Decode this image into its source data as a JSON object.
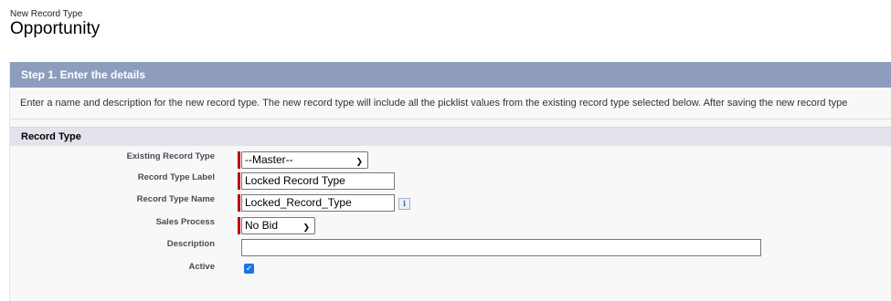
{
  "header": {
    "subtitle": "New Record Type",
    "title": "Opportunity"
  },
  "step": {
    "title": "Step 1. Enter the details",
    "description": "Enter a name and description for the new record type. The new record type will include all the picklist values from the existing record type selected below. After saving the new record type"
  },
  "section": {
    "title": "Record Type"
  },
  "form": {
    "existing_record_type": {
      "label": "Existing Record Type",
      "value": "--Master--",
      "required": true
    },
    "record_type_label": {
      "label": "Record Type Label",
      "value": "Locked Record Type",
      "required": true
    },
    "record_type_name": {
      "label": "Record Type Name",
      "value": "Locked_Record_Type",
      "required": true,
      "info_icon": "info-icon"
    },
    "sales_process": {
      "label": "Sales Process",
      "value": "No Bid",
      "required": true
    },
    "description": {
      "label": "Description",
      "value": ""
    },
    "active": {
      "label": "Active",
      "checked": true
    }
  },
  "colors": {
    "step_bar": "#8e9dbe",
    "required": "#c00000",
    "checkbox": "#1a73e8",
    "section_header": "#e3e3ec"
  }
}
